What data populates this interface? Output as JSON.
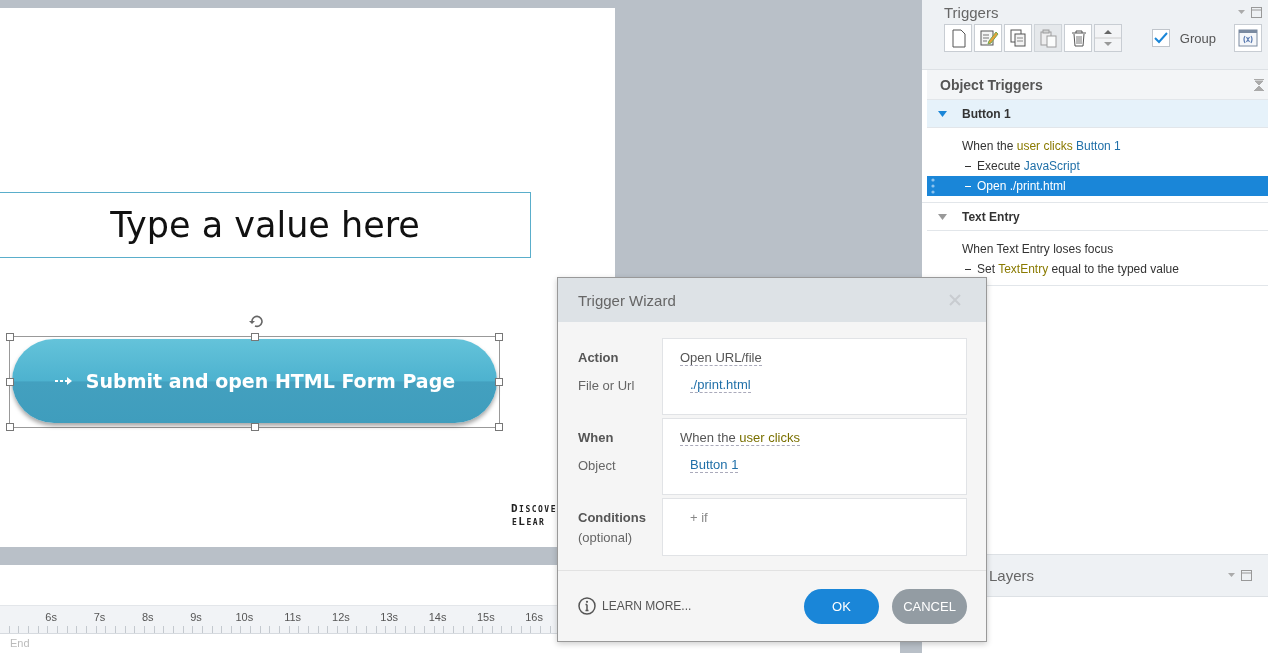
{
  "slide": {
    "text_entry": {
      "value": "Type a value here"
    },
    "button": {
      "label": "Submit and open HTML Form Page",
      "selected": true
    },
    "logo": [
      "Discove",
      "eLear"
    ]
  },
  "timeline": {
    "ticks": [
      "6s",
      "7s",
      "8s",
      "9s",
      "10s",
      "11s",
      "12s",
      "13s",
      "14s",
      "15s",
      "16s"
    ],
    "end_label": "End"
  },
  "triggers_panel": {
    "title": "Triggers",
    "toolbar": [
      {
        "kind": "new",
        "disabled": false
      },
      {
        "kind": "edit",
        "disabled": false
      },
      {
        "kind": "copy",
        "disabled": false
      },
      {
        "kind": "paste",
        "disabled": true
      },
      {
        "kind": "delete",
        "disabled": false
      },
      {
        "kind": "move",
        "disabled": false
      }
    ],
    "group_option": {
      "label": "Group",
      "checked": true
    },
    "section_title": "Object Triggers",
    "groups": [
      {
        "name": "Button 1",
        "expanded": true,
        "selected": true,
        "lines": [
          {
            "kind": "event",
            "selected": false,
            "parts": [
              {
                "text": "When the ",
                "kind": "plain"
              },
              {
                "text": "user clicks",
                "kind": "keyword"
              },
              {
                "text": " Button 1",
                "kind": "object"
              }
            ]
          },
          {
            "kind": "action",
            "selected": false,
            "parts": [
              {
                "text": "Execute ",
                "kind": "plain"
              },
              {
                "text": "JavaScript",
                "kind": "object"
              }
            ]
          },
          {
            "kind": "action",
            "selected": true,
            "parts": [
              {
                "text": "Open ./print.html",
                "kind": "plain"
              }
            ]
          }
        ]
      },
      {
        "name": "Text Entry",
        "expanded": true,
        "selected": false,
        "lines": [
          {
            "kind": "event",
            "selected": false,
            "parts": [
              {
                "text": "When Text Entry loses focus",
                "kind": "plain"
              }
            ]
          },
          {
            "kind": "action",
            "selected": false,
            "parts": [
              {
                "text": "Set ",
                "kind": "plain"
              },
              {
                "text": "TextEntry",
                "kind": "keyword"
              },
              {
                "text": " equal to the typed value",
                "kind": "plain"
              }
            ]
          }
        ]
      }
    ]
  },
  "layers_panel": {
    "title": "Layers"
  },
  "dialog": {
    "title": "Trigger Wizard",
    "sections": [
      {
        "title": "Action",
        "subtitle": "File or Url",
        "lines": [
          {
            "kind": "summary",
            "parts": [
              {
                "text": "Open URL/file",
                "kind": "plain"
              }
            ]
          },
          {
            "kind": "value",
            "parts": [
              {
                "text": "./print.html",
                "kind": "object"
              }
            ]
          }
        ]
      },
      {
        "title": "When",
        "subtitle": "Object",
        "lines": [
          {
            "kind": "summary",
            "parts": [
              {
                "text": "When the ",
                "kind": "plain"
              },
              {
                "text": "user clicks",
                "kind": "keyword"
              }
            ]
          },
          {
            "kind": "value",
            "parts": [
              {
                "text": "Button 1",
                "kind": "object"
              }
            ]
          }
        ]
      },
      {
        "title": "Conditions",
        "subtitle": "(optional)",
        "lines": [
          {
            "kind": "add",
            "parts": [
              {
                "text": "+ if",
                "kind": "muted"
              }
            ]
          }
        ]
      }
    ],
    "learn_more": "LEARN MORE...",
    "ok": "OK",
    "cancel": "CANCEL"
  }
}
